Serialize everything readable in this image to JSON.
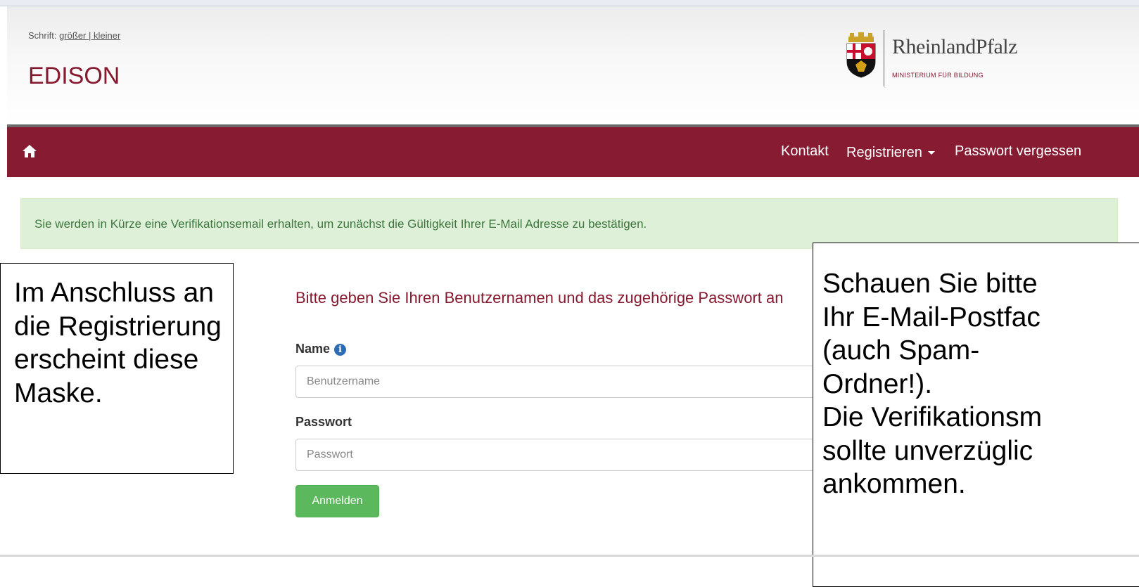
{
  "header": {
    "font_size_label": "Schrift:",
    "font_size_options": "größer | kleiner",
    "site_title": "EDISON",
    "logo": {
      "name": "RheinlandPfalz",
      "subtitle": "MINISTERIUM FÜR BILDUNG"
    }
  },
  "nav": {
    "home_icon": "home-icon",
    "items": [
      {
        "label": "Kontakt"
      },
      {
        "label": "Registrieren",
        "has_dropdown": true
      },
      {
        "label": "Passwort vergessen"
      }
    ]
  },
  "alert": {
    "text": "Sie werden in Kürze eine Verifikationsemail erhalten, um zunächst die Gültigkeit Ihrer E-Mail Adresse zu bestätigen."
  },
  "callouts": {
    "left": "Im Anschluss an die Registrierung erscheint diese Maske.",
    "right": "Schauen Sie bitte\nIhr E-Mail-Postfac\n(auch Spam-\nOrdner!).\nDie Verifikationsm\nsollte unverzüglic\nankommen."
  },
  "login": {
    "heading": "Bitte geben Sie Ihren Benutzernamen und das zugehörige Passwort an",
    "name_label": "Name",
    "name_placeholder": "Benutzername",
    "password_label": "Passwort",
    "password_placeholder": "Passwort",
    "submit_label": "Anmelden"
  },
  "colors": {
    "brand": "#861b32",
    "alert_bg": "#dff0d8",
    "alert_text": "#3c763d",
    "button": "#5cb85c"
  }
}
